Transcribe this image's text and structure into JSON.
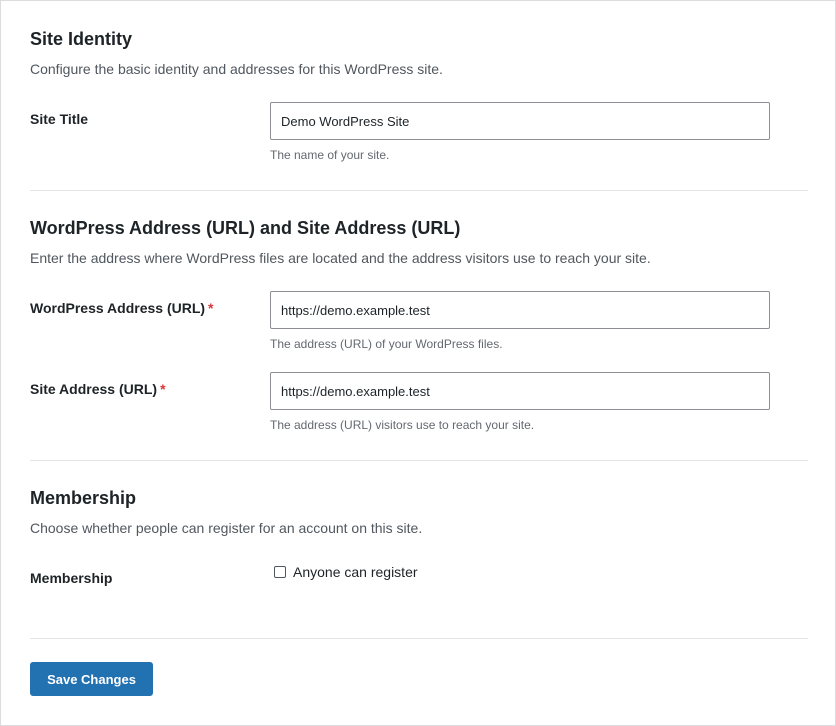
{
  "site_identity": {
    "title": "Site Identity",
    "description": "Configure the basic identity and addresses for this WordPress site.",
    "site_title_label": "Site Title",
    "site_title_value": "Demo WordPress Site",
    "site_title_hint": "The name of your site."
  },
  "addresses": {
    "title": "WordPress Address (URL) and Site Address (URL)",
    "description": "Enter the address where WordPress files are located and the address visitors use to reach your site.",
    "wp_address_label": "WordPress Address (URL)",
    "wp_address_value": "https://demo.example.test",
    "wp_address_hint": "The address (URL) of your WordPress files.",
    "site_address_label": "Site Address (URL)",
    "site_address_value": "https://demo.example.test",
    "site_address_hint": "The address (URL) visitors use to reach your site.",
    "required_marker": "*"
  },
  "membership": {
    "title": "Membership",
    "description": "Choose whether people can register for an account on this site.",
    "field_label": "Membership",
    "checkbox_label": "Anyone can register",
    "checkbox_checked": false
  },
  "actions": {
    "save_label": "Save Changes"
  },
  "colors": {
    "primary_button": "#2271b1",
    "required": "#d63638"
  }
}
